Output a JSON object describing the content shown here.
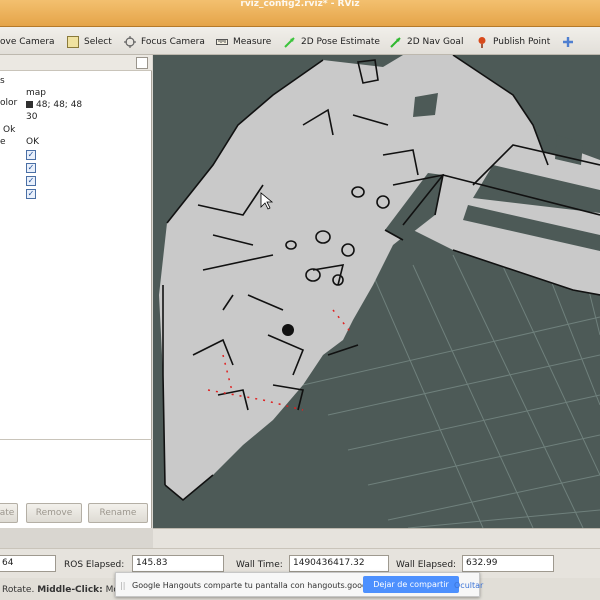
{
  "window": {
    "title": "rviz_config2.rviz* - RViz"
  },
  "toolbar": {
    "tools": [
      {
        "label": "ove Camera",
        "icon": "move-camera-icon"
      },
      {
        "label": "Select",
        "icon": "select-icon"
      },
      {
        "label": "Focus Camera",
        "icon": "focus-camera-icon"
      },
      {
        "label": "Measure",
        "icon": "measure-icon"
      },
      {
        "label": "2D Pose Estimate",
        "icon": "pose-estimate-arrow-icon"
      },
      {
        "label": "2D Nav Goal",
        "icon": "nav-goal-arrow-icon"
      },
      {
        "label": "Publish Point",
        "icon": "publish-point-pin-icon"
      },
      {
        "label": "",
        "icon": "add-tool-plus-icon"
      }
    ]
  },
  "displays": {
    "rows": [
      {
        "name": "s",
        "value": ""
      },
      {
        "name": "olor",
        "value": "map"
      },
      {
        "name": "",
        "value": "48; 48; 48",
        "swatch": "#303030"
      },
      {
        "name": "",
        "value": "30"
      },
      {
        "name": "Ok",
        "value": ""
      },
      {
        "name": "e",
        "value": "OK"
      }
    ],
    "checkboxes_checked": 4,
    "buttons": [
      "ate",
      "Remove",
      "Rename"
    ]
  },
  "map_colors": {
    "background": "#4d5a57",
    "free": "#c9c9c9",
    "occupied": "#111111",
    "grid": "#6f807c",
    "laser": "#e02020"
  },
  "time": {
    "ros_time_label": "",
    "ros_time_value": "64",
    "ros_elapsed_label": "ROS Elapsed:",
    "ros_elapsed_value": "145.83",
    "wall_time_label": "Wall Time:",
    "wall_time_value": "1490436417.32",
    "wall_elapsed_label": "Wall Elapsed:",
    "wall_elapsed_value": "632.99"
  },
  "status": {
    "text_prefix": "Rotate.",
    "text_bold": "Middle-Click:",
    "text_suffix": "Mo"
  },
  "notification": {
    "message": "Google Hangouts comparte tu pantalla con hangouts.google.com.",
    "share_label": "Dejar de compartir",
    "hide_label": "Ocultar"
  }
}
